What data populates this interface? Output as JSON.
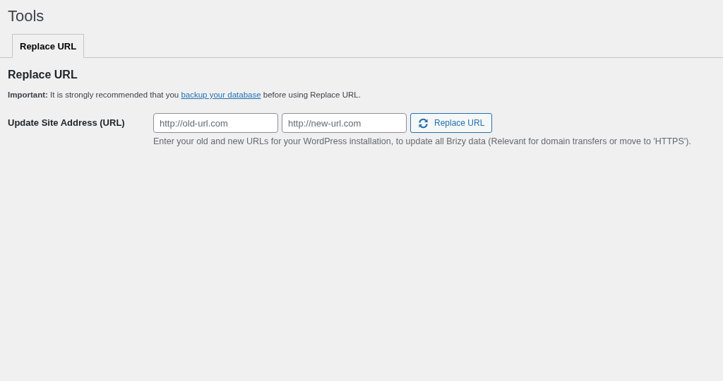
{
  "page_title": "Tools",
  "tabs": [
    {
      "label": "Replace URL",
      "selected": true
    }
  ],
  "section_title": "Replace URL",
  "notice": {
    "lead": "Important:",
    "before": "It is strongly recommended that you",
    "link": "backup your database",
    "after": "before using Replace URL."
  },
  "form": {
    "label": "Update Site Address (URL)",
    "fields": [
      {
        "placeholder": "http://old-url.com"
      },
      {
        "placeholder": "http://new-url.com"
      }
    ],
    "button": "Replace URL",
    "help": "Enter your old and new URLs for your WordPress installation, to update all Brizy data (Relevant for domain transfers or move to 'HTTPS')."
  }
}
